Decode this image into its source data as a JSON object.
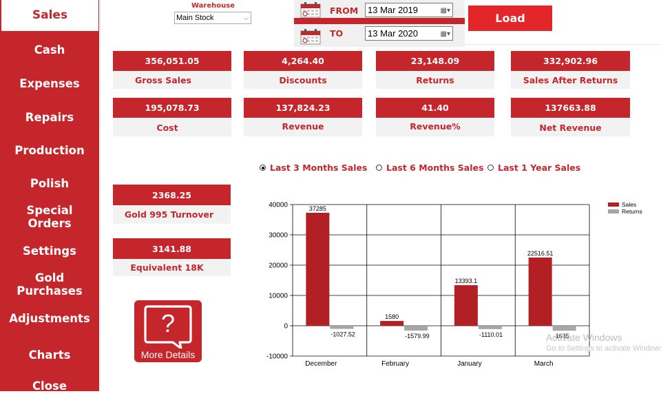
{
  "sidebar": {
    "items": [
      {
        "label": "Sales",
        "active": true
      },
      {
        "label": "Cash"
      },
      {
        "label": "Expenses"
      },
      {
        "label": "Repairs"
      },
      {
        "label": "Production"
      },
      {
        "label": "Polish"
      },
      {
        "label": "Special Orders"
      },
      {
        "label": "Settings"
      },
      {
        "label": "Gold Purchases"
      },
      {
        "label": "Adjustments"
      },
      {
        "label": "Charts"
      },
      {
        "label": "Close"
      }
    ]
  },
  "warehouse": {
    "label": "Warehouse",
    "value": "Main Stock"
  },
  "date_range": {
    "from_label": "FROM",
    "from_value": "13 Mar 2019",
    "to_label": "TO",
    "to_value": "13 Mar 2020"
  },
  "load_button": "Load",
  "summary": {
    "row1": [
      {
        "value": "356,051.05",
        "label": "Gross Sales"
      },
      {
        "value": "4,264.40",
        "label": "Discounts"
      },
      {
        "value": "23,148.09",
        "label": "Returns"
      },
      {
        "value": "332,902.96",
        "label": "Sales After Returns"
      }
    ],
    "row2": [
      {
        "value": "195,078.73",
        "label": "Cost"
      },
      {
        "value": "137,824.23",
        "label": "Revenue"
      },
      {
        "value": "41.40",
        "label": "Revenue%"
      },
      {
        "value": "137663.88",
        "label": "Net Revenue"
      }
    ]
  },
  "gold": {
    "turnover_value": "2368.25",
    "turnover_label": "Gold 995 Turnover",
    "equivalent_value": "3141.88",
    "equivalent_label": "Equivalent 18K"
  },
  "period_options": [
    {
      "label": "Last 3 Months Sales",
      "selected": true
    },
    {
      "label": "Last 6 Months Sales",
      "selected": false
    },
    {
      "label": "Last 1 Year Sales",
      "selected": false
    }
  ],
  "more_details": {
    "label": "More Details",
    "icon": "question-speech-bubble-icon"
  },
  "chart_data": {
    "type": "bar",
    "categories": [
      "December",
      "February",
      "January",
      "March"
    ],
    "series": [
      {
        "name": "Sales",
        "values": [
          37285,
          1580,
          13393.1,
          22516.51
        ],
        "labels": [
          "37285",
          "1580",
          "13393.1",
          "22516.51"
        ],
        "color": "#b22025"
      },
      {
        "name": "Returns",
        "values": [
          -1027.52,
          -1579.99,
          -1110.01,
          -1635
        ],
        "labels": [
          "-1027.52",
          "-1579.99",
          "-1110.01",
          "-1635"
        ],
        "color": "#a6a6a6"
      }
    ],
    "ylim": [
      -10000,
      40000
    ],
    "yticks": [
      "-10000",
      "0",
      "10000",
      "20000",
      "30000",
      "40000"
    ],
    "grid": true,
    "legend": "top-right"
  },
  "watermark": {
    "line1": "Activate Windows",
    "line2": "Go to Settings to activate Windows."
  },
  "colors": {
    "accent": "#c4262b",
    "load": "#e3262a",
    "tile_label_bg": "#f2f2f2"
  }
}
